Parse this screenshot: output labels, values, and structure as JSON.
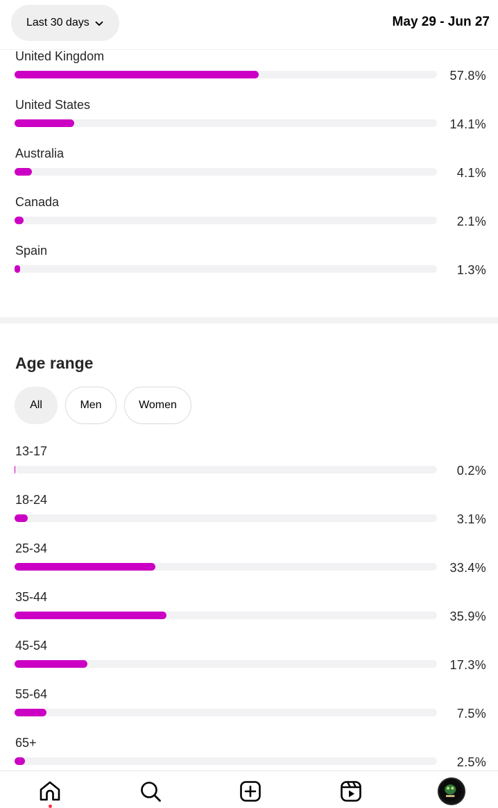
{
  "header": {
    "range_label": "Last 30 days",
    "date_range": "May 29 - Jun 27"
  },
  "countries": [
    {
      "label": "United Kingdom",
      "pct": "57.8%",
      "value": 57.8
    },
    {
      "label": "United States",
      "pct": "14.1%",
      "value": 14.1
    },
    {
      "label": "Australia",
      "pct": "4.1%",
      "value": 4.1
    },
    {
      "label": "Canada",
      "pct": "2.1%",
      "value": 2.1
    },
    {
      "label": "Spain",
      "pct": "1.3%",
      "value": 1.3
    }
  ],
  "age_section": {
    "title": "Age range",
    "filters": [
      {
        "label": "All",
        "active": true
      },
      {
        "label": "Men",
        "active": false
      },
      {
        "label": "Women",
        "active": false
      }
    ],
    "rows": [
      {
        "label": "13-17",
        "pct": "0.2%",
        "value": 0.2
      },
      {
        "label": "18-24",
        "pct": "3.1%",
        "value": 3.1
      },
      {
        "label": "25-34",
        "pct": "33.4%",
        "value": 33.4
      },
      {
        "label": "35-44",
        "pct": "35.9%",
        "value": 35.9
      },
      {
        "label": "45-54",
        "pct": "17.3%",
        "value": 17.3
      },
      {
        "label": "55-64",
        "pct": "7.5%",
        "value": 7.5
      },
      {
        "label": "65+",
        "pct": "2.5%",
        "value": 2.5
      }
    ]
  },
  "colors": {
    "bar_fill": "#cc00c4",
    "bar_track": "#f2f2f4",
    "notification_dot": "#ff3040"
  },
  "nav": {
    "items": [
      "home-icon",
      "search-icon",
      "create-icon",
      "reels-icon",
      "profile-avatar"
    ]
  }
}
